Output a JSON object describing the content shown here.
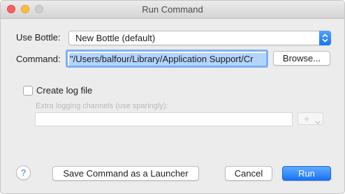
{
  "window": {
    "title": "Run Command"
  },
  "form": {
    "bottle_label": "Use Bottle:",
    "bottle_value": "New Bottle (default)",
    "command_label": "Command:",
    "command_value": "\"/Users/balfour/Library/Application Support/Cr",
    "browse_label": "Browse...",
    "log_checkbox_label": "Create log file",
    "log_checkbox_checked": false,
    "extra_channels_label": "Extra logging channels (use sparingly):",
    "extra_channels_value": "",
    "add_channel_glyph": "+"
  },
  "footer": {
    "help_glyph": "?",
    "save_launcher_label": "Save Command as a Launcher",
    "cancel_label": "Cancel",
    "run_label": "Run"
  },
  "colors": {
    "accent": "#1874f4",
    "focus_ring": "#7fb0f2",
    "selection": "#b3d4ff",
    "close": "#fc605c",
    "minimize": "#fdbc40",
    "zoom_disabled": "#cfcfcf"
  },
  "icons": {
    "close": "close-icon",
    "minimize": "minimize-icon",
    "zoom": "zoom-icon",
    "stepper": "chevron-up-down-icon",
    "add": "plus-icon",
    "add_menu": "chevron-down-icon",
    "help": "help-icon"
  }
}
